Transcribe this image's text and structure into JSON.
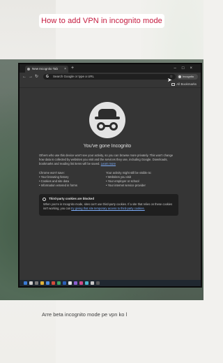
{
  "video_title": "How to add VPN in incognito mode",
  "caption": "Arre beta incognito mode pe vpn ko l",
  "browser": {
    "tab_label": "New Incognito Tab",
    "new_tab_glyph": "+",
    "tab_close_glyph": "×",
    "window_controls": "–□×",
    "nav": {
      "back": "←",
      "forward": "→",
      "reload": "↻"
    },
    "omnibox_placeholder": "Search Google or type a URL",
    "incognito_chip_label": "Incognito",
    "all_bookmarks_label": "All Bookmarks"
  },
  "incognito_page": {
    "heading": "You've gone Incognito",
    "intro_text": "Others who use this device won't see your activity, so you can browse more privately. This won't change how data is collected by websites you visit and the services they use, including Google. Downloads, bookmarks and reading list items will be saved.",
    "learn_more": "Learn more",
    "left_heading": "Chrome won't save:",
    "left_items": [
      "Your browsing history",
      "Cookies and site data",
      "Information entered in forms"
    ],
    "right_heading": "Your activity might still be visible to:",
    "right_items": [
      "Websites you visit",
      "Your employer or school",
      "Your internet service provider"
    ],
    "cookie_title": "Third-party cookies are blocked",
    "cookie_text": "When you're in Incognito mode, sites can't use third-party cookies. If a site that relies on these cookies isn't working, you can",
    "cookie_link": "try giving that site temporary access to third-party cookies."
  },
  "icons": [
    "google-icon",
    "star-icon",
    "incognito-icon",
    "folder-icon",
    "cookie-icon",
    "cursor-icon"
  ],
  "colors": {
    "title_text": "#c4183c",
    "page_bg": "#353535",
    "link": "#7cacf8"
  }
}
